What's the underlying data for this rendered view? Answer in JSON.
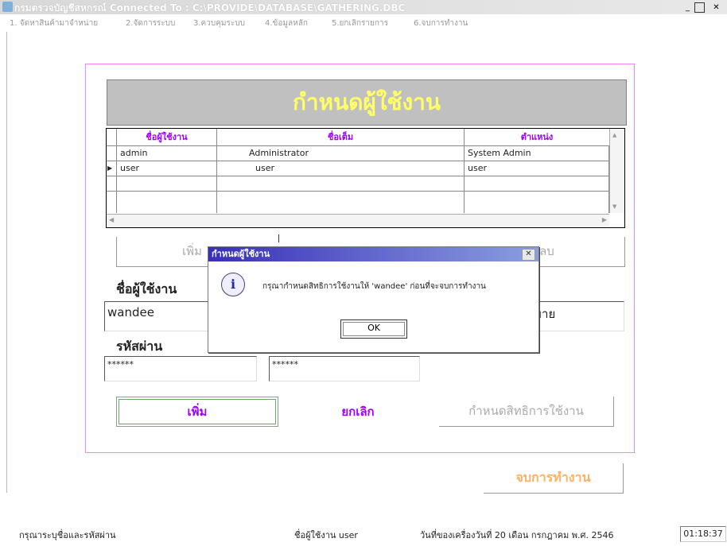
{
  "window": {
    "title": "กรมตรวจบัญชีสหกรณ์    Connected  To  : C:\\PROVIDE\\DATABASE\\GATHERING.DBC",
    "minimize": "_",
    "maximize": "□",
    "close": "✕"
  },
  "menu": [
    "1. จัดหาสินค้ามาจำหน่าย",
    "2.จัดการระบบ",
    "3.ควบคุมระบบ",
    "4.ข้อมูลหลัก",
    "5.ยกเลิกรายการ",
    "6.จบการทำงาน"
  ],
  "form": {
    "header": "กำหนดผู้ใช้งาน",
    "grid": {
      "columns": [
        "ชื่อผู้ใช้งาน",
        "ชื่อเต็ม",
        "ตำแหน่ง"
      ],
      "rows": [
        [
          "admin",
          "Administrator",
          "System Admin"
        ],
        [
          "user",
          "user",
          "user"
        ]
      ],
      "current_row_marker": "▶"
    },
    "top_buttons": {
      "add_partial": "เพิ่ม",
      "delete_partial": "ลบ"
    },
    "username_label": "ชื่อผู้ใช้งาน",
    "username_value": "wandee",
    "position_partial": "ยขาย",
    "password_label": "รหัสผ่าน",
    "password_value": "******",
    "password_confirm_value": "******",
    "buttons": {
      "add": "เพิ่ม",
      "cancel": "ยกเลิก",
      "permissions": "กำหนดสิทธิการใช้งาน"
    },
    "exit": "จบการทำงาน"
  },
  "dialog": {
    "title": "กำหนดผู้ใช้งาน",
    "close": "✕",
    "icon": "i",
    "message": "กรุณากำหนดสิทธิการใช้งานให้ 'wandee' ก่อนที่จะจบการทำงาน",
    "ok": "OK"
  },
  "status": {
    "prompt": "กรุณาระบุชื่อและรหัสผ่าน",
    "user": "ชื่อผู้ใช้งาน user",
    "date": "วันที่ของเครื่องวันที่ 20 เดือน กรกฎาคม  พ.ศ. 2546",
    "time": "01:18:37"
  },
  "colors": {
    "accent_purple": "#a000ff",
    "header_yellow": "#ffff66",
    "exit_orange": "#ffb060",
    "frame_pink": "#ff80ff",
    "dialog_blue": "#3a2fb8"
  }
}
